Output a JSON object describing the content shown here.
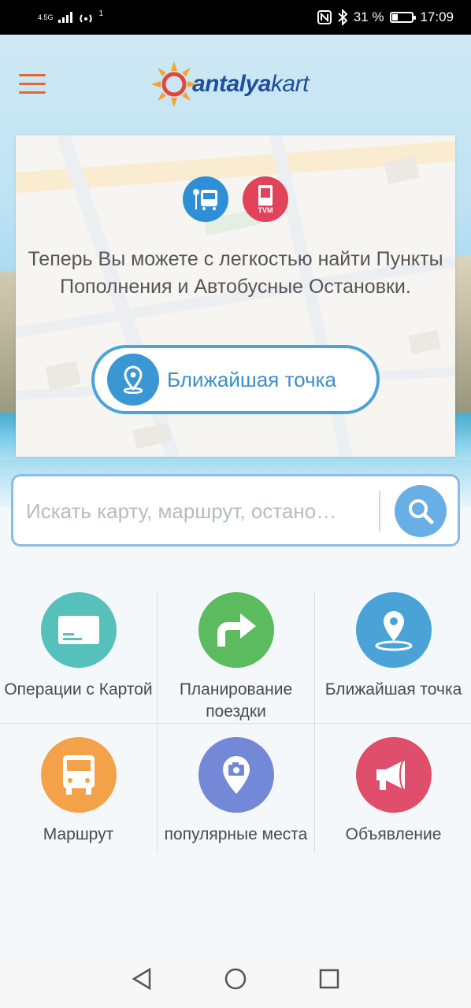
{
  "status_bar": {
    "network": "4.5G",
    "hotspot_count": "1",
    "battery_percent": "31 %",
    "battery_level": 0.31,
    "time": "17:09"
  },
  "header": {
    "logo_text_main": "antalya",
    "logo_text_accent": "kart",
    "accent_color": "#e0673a",
    "brand_color": "#1e4e9c"
  },
  "info_card": {
    "bus_stop_icon": "bus-stop-icon",
    "tvm_icon_label": "TVM",
    "message": "Теперь Вы можете с легкостью найти Пункты Пополнения и Автобусные Остановки.",
    "nearest_button_label": "Ближайшая точка"
  },
  "search": {
    "placeholder": "Искать карту, маршрут, остано…"
  },
  "menu": [
    {
      "label": "Операции с Картой",
      "icon": "card-icon",
      "color": "#55c1ba"
    },
    {
      "label": "Планирование поездки",
      "icon": "turn-right-arrow-icon",
      "color": "#5cbb5f"
    },
    {
      "label": "Ближайшая точка",
      "icon": "location-pin-icon",
      "color": "#4aa3d6"
    },
    {
      "label": "Маршрут",
      "icon": "bus-icon",
      "color": "#f3a24a"
    },
    {
      "label": "популярные места",
      "icon": "camera-pin-icon",
      "color": "#7488d8"
    },
    {
      "label": "Объявление",
      "icon": "megaphone-icon",
      "color": "#df4f6c"
    }
  ],
  "nav": {
    "back": "back-icon",
    "home": "home-icon",
    "recents": "recents-icon"
  }
}
